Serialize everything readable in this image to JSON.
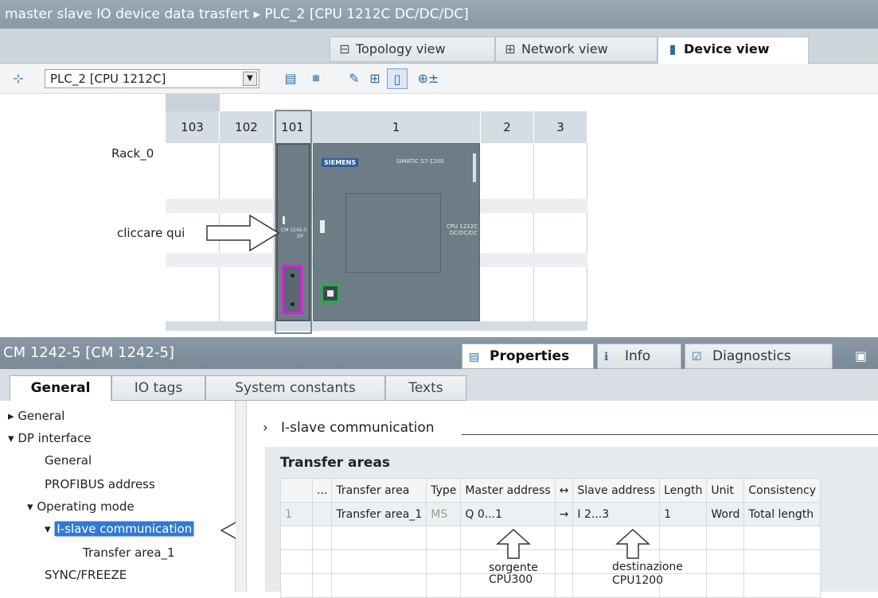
{
  "title": "master slave IO device data trasfert ▸ PLC_2 [CPU 1212C DC/DC/DC]",
  "view_tabs": {
    "topology": "Topology view",
    "network": "Network view",
    "device": "Device view"
  },
  "toolbar": {
    "device_selector": "PLC_2 [CPU 1212C]"
  },
  "rack": {
    "name": "Rack_0",
    "slots": [
      "103",
      "102",
      "101",
      "1",
      "2",
      "3"
    ],
    "cm_label_line1": "CM 1242-5",
    "cm_label_line2": "DP",
    "brand": "SIEMENS",
    "product": "SIMATIC S7-1200",
    "cpu_label": "CPU 1212C DC/DC/DC"
  },
  "annotations": {
    "click_here": "cliccare qui",
    "source_l1": "sorgente",
    "source_l2": "CPU300",
    "dest_l1": "destinazione",
    "dest_l2": "CPU1200"
  },
  "inspector": {
    "title": "CM 1242-5 [CM 1242-5]",
    "tabs": {
      "properties": "Properties",
      "info": "Info",
      "diagnostics": "Diagnostics"
    }
  },
  "prop_tabs": {
    "general": "General",
    "io_tags": "IO tags",
    "system_constants": "System constants",
    "texts": "Texts"
  },
  "tree": {
    "general": "General",
    "dp_interface": "DP interface",
    "dp_general": "General",
    "profibus": "PROFIBUS address",
    "operating_mode": "Operating mode",
    "islave": "I-slave communication",
    "transfer_area": "Transfer area_1",
    "sync": "SYNC/FREEZE"
  },
  "section": {
    "header": "I-slave communication",
    "transfer_title": "Transfer areas"
  },
  "table": {
    "headers": {
      "dots": "...",
      "area": "Transfer area",
      "type": "Type",
      "master": "Master address",
      "swap": "↔",
      "slave": "Slave address",
      "length": "Length",
      "unit": "Unit",
      "consistency": "Consistency"
    },
    "row": {
      "index": "1",
      "area": "Transfer area_1",
      "type": "MS",
      "master": "Q 0...1",
      "arrow": "→",
      "slave": "I 2...3",
      "length": "1",
      "unit": "Word",
      "consistency": "Total length"
    }
  }
}
